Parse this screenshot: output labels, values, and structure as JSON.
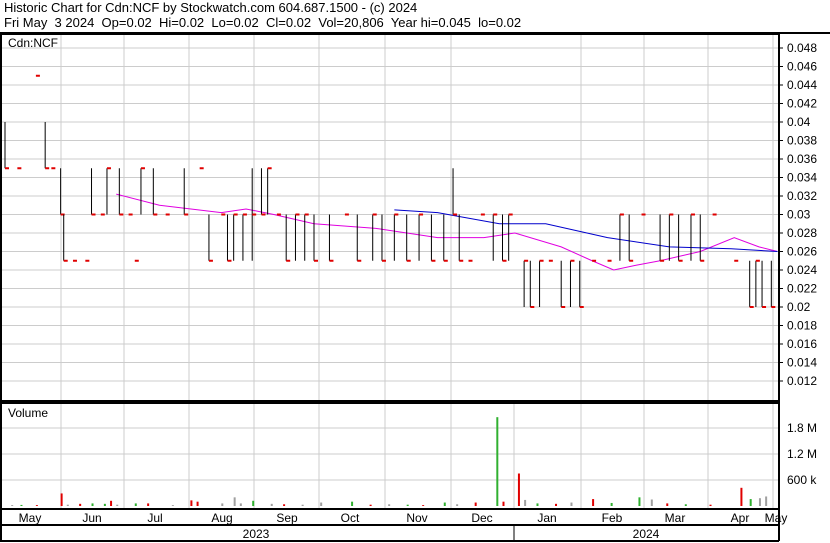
{
  "header": {
    "title": "Historic Chart for Cdn:NCF by Stockwatch.com 604.687.1500 - (c) 2024",
    "quote": "Fri May  3 2024  Op=0.02  Hi=0.02  Lo=0.02  Cl=0.02  Vol=20,806  Year hi=0.045  lo=0.02"
  },
  "chart_data": {
    "type": "line",
    "symbol_label": "Cdn:NCF",
    "volume_label": "Volume",
    "price_ticks": [
      "0.048",
      "0.046",
      "0.044",
      "0.042",
      "0.04",
      "0.038",
      "0.036",
      "0.034",
      "0.032",
      "0.03",
      "0.028",
      "0.026",
      "0.024",
      "0.022",
      "0.02",
      "0.018",
      "0.016",
      "0.014",
      "0.012"
    ],
    "price_ylim": [
      0.012,
      0.048
    ],
    "volume_ticks": [
      {
        "v": 1800000,
        "label": "1.8 M"
      },
      {
        "v": 1200000,
        "label": "1.2 M"
      },
      {
        "v": 600000,
        "label": "600 k"
      }
    ],
    "months": [
      "May",
      "Jun",
      "Jul",
      "Aug",
      "Sep",
      "Oct",
      "Nov",
      "Dec",
      "Jan",
      "Feb",
      "Mar",
      "Apr",
      "May"
    ],
    "years": [
      "2023",
      "2024"
    ],
    "colors": {
      "up": "#000000",
      "close": "#e00000",
      "ma_long": "#0000cc",
      "ma_short": "#e000e0",
      "vol_up": "#30b030",
      "vol_down": "#e00000",
      "vol_flat": "#a0a0a0"
    },
    "bars": [
      [
        0,
        0.04,
        0.035,
        0.035
      ],
      [
        4,
        0.035,
        0.035,
        0.035
      ],
      [
        10,
        0.045,
        0.045,
        0.045
      ],
      [
        13,
        0.04,
        0.035,
        0.035
      ],
      [
        15,
        0.035,
        0.035,
        0.035
      ],
      [
        18,
        0.035,
        0.03,
        0.03
      ],
      [
        19,
        0.03,
        0.025,
        0.025
      ],
      [
        22,
        0.025,
        0.025,
        0.025
      ],
      [
        26,
        0.025,
        0.025,
        0.025
      ],
      [
        28,
        0.035,
        0.03,
        0.03
      ],
      [
        31,
        0.03,
        0.03,
        0.03
      ],
      [
        33,
        0.035,
        0.03,
        0.035
      ],
      [
        37,
        0.035,
        0.03,
        0.03
      ],
      [
        40,
        0.03,
        0.03,
        0.03
      ],
      [
        42,
        0.025,
        0.025,
        0.025
      ],
      [
        44,
        0.035,
        0.03,
        0.035
      ],
      [
        48,
        0.035,
        0.03,
        0.03
      ],
      [
        52,
        0.03,
        0.03,
        0.03
      ],
      [
        58,
        0.035,
        0.03,
        0.03
      ],
      [
        63,
        0.035,
        0.035,
        0.035
      ],
      [
        66,
        0.03,
        0.025,
        0.025
      ],
      [
        70,
        0.03,
        0.03,
        0.03
      ],
      [
        72,
        0.03,
        0.025,
        0.025
      ],
      [
        74,
        0.03,
        0.025,
        0.03
      ],
      [
        77,
        0.03,
        0.025,
        0.03
      ],
      [
        80,
        0.035,
        0.025,
        0.03
      ],
      [
        83,
        0.035,
        0.03,
        0.03
      ],
      [
        85,
        0.035,
        0.03,
        0.035
      ],
      [
        88,
        0.03,
        0.03,
        0.03
      ],
      [
        91,
        0.03,
        0.025,
        0.025
      ],
      [
        94,
        0.03,
        0.025,
        0.03
      ],
      [
        97,
        0.03,
        0.025,
        0.03
      ],
      [
        100,
        0.03,
        0.025,
        0.025
      ],
      [
        105,
        0.03,
        0.025,
        0.025
      ],
      [
        110,
        0.03,
        0.03,
        0.03
      ],
      [
        114,
        0.03,
        0.025,
        0.025
      ],
      [
        119,
        0.03,
        0.025,
        0.03
      ],
      [
        122,
        0.03,
        0.025,
        0.025
      ],
      [
        126,
        0.03,
        0.025,
        0.03
      ],
      [
        130,
        0.03,
        0.025,
        0.025
      ],
      [
        134,
        0.03,
        0.025,
        0.03
      ],
      [
        138,
        0.03,
        0.025,
        0.025
      ],
      [
        142,
        0.03,
        0.025,
        0.025
      ],
      [
        145,
        0.035,
        0.03,
        0.03
      ],
      [
        147,
        0.03,
        0.025,
        0.025
      ],
      [
        150,
        0.025,
        0.025,
        0.025
      ],
      [
        154,
        0.03,
        0.03,
        0.03
      ],
      [
        158,
        0.03,
        0.025,
        0.03
      ],
      [
        161,
        0.03,
        0.025,
        0.025
      ],
      [
        163,
        0.03,
        0.025,
        0.03
      ],
      [
        168,
        0.025,
        0.02,
        0.025
      ],
      [
        170,
        0.025,
        0.02,
        0.02
      ],
      [
        173,
        0.025,
        0.02,
        0.025
      ],
      [
        176,
        0.025,
        0.025,
        0.025
      ],
      [
        180,
        0.025,
        0.02,
        0.02
      ],
      [
        183,
        0.025,
        0.02,
        0.025
      ],
      [
        186,
        0.025,
        0.02,
        0.02
      ],
      [
        190,
        0.025,
        0.025,
        0.025
      ],
      [
        195,
        0.025,
        0.025,
        0.025
      ],
      [
        199,
        0.03,
        0.025,
        0.03
      ],
      [
        202,
        0.03,
        0.025,
        0.025
      ],
      [
        206,
        0.03,
        0.03,
        0.03
      ],
      [
        212,
        0.03,
        0.025,
        0.025
      ],
      [
        215,
        0.03,
        0.025,
        0.03
      ],
      [
        218,
        0.03,
        0.025,
        0.025
      ],
      [
        222,
        0.03,
        0.025,
        0.03
      ],
      [
        225,
        0.03,
        0.025,
        0.025
      ],
      [
        229,
        0.03,
        0.03,
        0.03
      ],
      [
        236,
        0.025,
        0.025,
        0.025
      ],
      [
        241,
        0.025,
        0.02,
        0.02
      ],
      [
        243,
        0.025,
        0.02,
        0.025
      ],
      [
        245,
        0.025,
        0.02,
        0.02
      ],
      [
        248,
        0.025,
        0.02,
        0.02
      ]
    ],
    "ma_long": [
      [
        126,
        0.0305
      ],
      [
        140,
        0.0302
      ],
      [
        160,
        0.029
      ],
      [
        175,
        0.029
      ],
      [
        195,
        0.0275
      ],
      [
        215,
        0.0265
      ],
      [
        235,
        0.0263
      ],
      [
        250,
        0.026
      ]
    ],
    "ma_short": [
      [
        36,
        0.0322
      ],
      [
        50,
        0.031
      ],
      [
        70,
        0.0302
      ],
      [
        78,
        0.0306
      ],
      [
        87,
        0.03
      ],
      [
        100,
        0.029
      ],
      [
        120,
        0.0285
      ],
      [
        140,
        0.0275
      ],
      [
        155,
        0.0275
      ],
      [
        165,
        0.028
      ],
      [
        180,
        0.0265
      ],
      [
        190,
        0.025
      ],
      [
        197,
        0.024
      ],
      [
        204,
        0.0245
      ],
      [
        212,
        0.025
      ],
      [
        225,
        0.026
      ],
      [
        236,
        0.0275
      ],
      [
        244,
        0.0265
      ],
      [
        250,
        0.026
      ]
    ],
    "volume": [
      [
        2,
        20000,
        "f"
      ],
      [
        5,
        25000,
        "u"
      ],
      [
        10,
        20000,
        "d"
      ],
      [
        18,
        290000,
        "d"
      ],
      [
        20,
        30000,
        "f"
      ],
      [
        24,
        50000,
        "d"
      ],
      [
        28,
        60000,
        "u"
      ],
      [
        32,
        50000,
        "u"
      ],
      [
        34,
        120000,
        "d"
      ],
      [
        36,
        30000,
        "f"
      ],
      [
        42,
        60000,
        "u"
      ],
      [
        46,
        60000,
        "d"
      ],
      [
        54,
        20000,
        "f"
      ],
      [
        60,
        130000,
        "d"
      ],
      [
        62,
        100000,
        "d"
      ],
      [
        70,
        60000,
        "f"
      ],
      [
        74,
        200000,
        "f"
      ],
      [
        76,
        60000,
        "f"
      ],
      [
        80,
        120000,
        "u"
      ],
      [
        86,
        50000,
        "f"
      ],
      [
        90,
        40000,
        "d"
      ],
      [
        96,
        30000,
        "f"
      ],
      [
        102,
        80000,
        "f"
      ],
      [
        112,
        100000,
        "u"
      ],
      [
        118,
        30000,
        "d"
      ],
      [
        124,
        40000,
        "f"
      ],
      [
        130,
        30000,
        "u"
      ],
      [
        135,
        20000,
        "d"
      ],
      [
        142,
        80000,
        "u"
      ],
      [
        146,
        40000,
        "f"
      ],
      [
        152,
        80000,
        "d"
      ],
      [
        159,
        2050000,
        "u"
      ],
      [
        161,
        100000,
        "d"
      ],
      [
        166,
        750000,
        "d"
      ],
      [
        168,
        140000,
        "f"
      ],
      [
        172,
        60000,
        "u"
      ],
      [
        178,
        50000,
        "d"
      ],
      [
        183,
        80000,
        "f"
      ],
      [
        190,
        160000,
        "d"
      ],
      [
        196,
        70000,
        "u"
      ],
      [
        205,
        200000,
        "u"
      ],
      [
        209,
        150000,
        "f"
      ],
      [
        214,
        60000,
        "d"
      ],
      [
        220,
        40000,
        "u"
      ],
      [
        228,
        30000,
        "d"
      ],
      [
        238,
        420000,
        "d"
      ],
      [
        241,
        160000,
        "u"
      ],
      [
        244,
        180000,
        "f"
      ],
      [
        246,
        220000,
        "f"
      ]
    ]
  }
}
